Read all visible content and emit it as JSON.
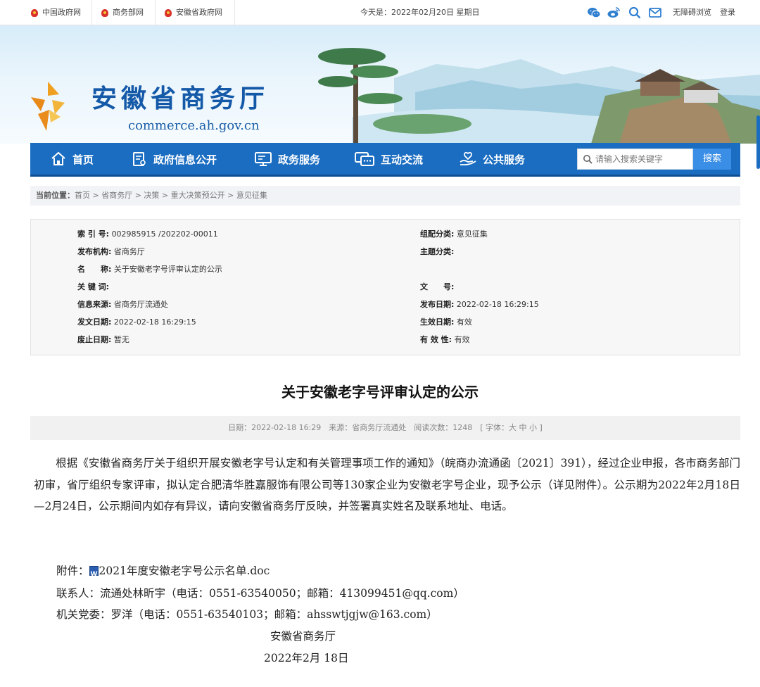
{
  "topbar": {
    "links": [
      "中国政府网",
      "商务部网",
      "安徽省政府网"
    ],
    "today": "今天是：2022年02月20日 星期日",
    "icons": [
      "wechat-icon",
      "weibo-icon",
      "search-icon",
      "mail-icon"
    ],
    "accessibility": "无障碍浏览",
    "login": "登录"
  },
  "site": {
    "title": "安徽省商务厅",
    "domain": "commerce.ah.gov.cn"
  },
  "nav": {
    "items": [
      {
        "label": "首页",
        "icon": "home-icon"
      },
      {
        "label": "政府信息公开",
        "icon": "document-icon"
      },
      {
        "label": "政务服务",
        "icon": "monitor-icon"
      },
      {
        "label": "互动交流",
        "icon": "chat-icon"
      },
      {
        "label": "公共服务",
        "icon": "service-icon"
      }
    ],
    "search_placeholder": "请输入搜索关键字",
    "search_button": "搜索"
  },
  "breadcrumb": {
    "label": "当前位置：",
    "path": "首页 > 省商务厅 > 决策 > 重大决策预公开 > 意见征集"
  },
  "meta": {
    "left": [
      {
        "key": "索 引 号:",
        "value": "002985915 /202202-00011"
      },
      {
        "key": "发布机构:",
        "value": "省商务厅"
      },
      {
        "key": "名　　称:",
        "value": "关于安徽老字号评审认定的公示"
      },
      {
        "key": "关 键 词:",
        "value": ""
      },
      {
        "key": "信息来源:",
        "value": "省商务厅流通处"
      },
      {
        "key": "发文日期:",
        "value": "2022-02-18 16:29:15"
      },
      {
        "key": "废止日期:",
        "value": "暂无"
      }
    ],
    "right": [
      {
        "key": "组配分类:",
        "value": "意见征集"
      },
      {
        "key": "主题分类:",
        "value": ""
      },
      {
        "key": "",
        "value": ""
      },
      {
        "key": "文　　号:",
        "value": ""
      },
      {
        "key": "发布日期:",
        "value": "2022-02-18 16:29:15"
      },
      {
        "key": "生效日期:",
        "value": "有效"
      },
      {
        "key": "有 效 性:",
        "value": "有效"
      }
    ]
  },
  "article": {
    "title": "关于安徽老字号评审认定的公示",
    "info": "日期：2022-02-18 16:29　来源：省商务厅流通处　阅读次数：1248　[ 字体：大 中 小 ]",
    "body": "　　根据《安徽省商务厅关于组织开展安徽老字号认定和有关管理事项工作的通知》（皖商办流通函〔2021〕391），经过企业申报，各市商务部门初审，省厅组织专家评审，拟认定合肥清华胜嘉服饰有限公司等130家企业为安徽老字号企业，现予公示（详见附件）。公示期为2022年2月18日—2月24日，公示期间内如存有异议，请向安徽省商务厅反映，并签署真实姓名及联系地址、电话。",
    "attachment_label": "附件：",
    "attachment_file": "2021年度安徽老字号公示名单.doc",
    "contact1": "联系人：流通处林昕宇（电话：0551-63540050；邮箱：413099451@qq.com）",
    "contact2": "机关党委：罗洋（电话：0551-63540103；邮箱：ahsswtjgjw@163.com）",
    "signature": "安徽省商务厅",
    "date": "2022年2月 18日"
  },
  "colors": {
    "nav": "#1b6dc1",
    "title": "#1459a8",
    "search_button": "#3a8ee6"
  }
}
